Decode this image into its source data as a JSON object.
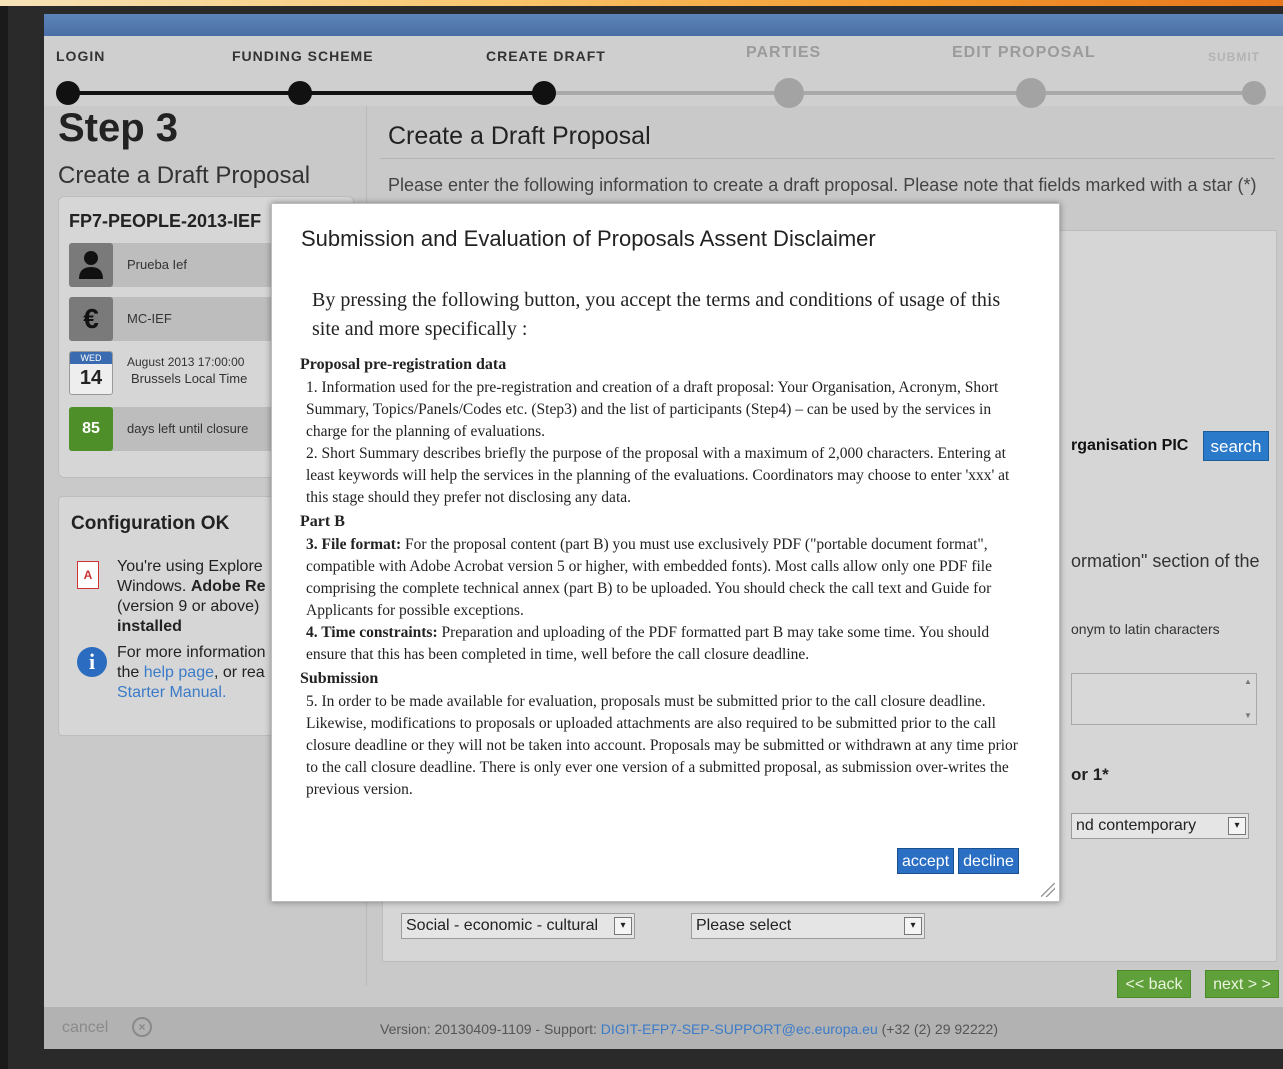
{
  "steps": [
    {
      "label": "LOGIN"
    },
    {
      "label": "FUNDING SCHEME"
    },
    {
      "label": "CREATE DRAFT"
    },
    {
      "label": "PARTIES"
    },
    {
      "label": "EDIT PROPOSAL"
    },
    {
      "label": "SUBMIT"
    }
  ],
  "left": {
    "step_number": "Step 3",
    "step_subtitle": "Create a Draft Proposal",
    "call_id": "FP7-PEOPLE-2013-IEF",
    "acronym": "Prueba Ief",
    "scheme": "MC-IEF",
    "deadline_line1": "August 2013 17:00:00",
    "deadline_line2": "Brussels Local Time",
    "deadline_dow": "WED",
    "deadline_day": "14",
    "days_left": "85",
    "days_left_label": "days left until closure",
    "config_title": "Configuration OK",
    "config_text_1": "You're using Explore",
    "config_text_2": "Windows.",
    "config_text_bold": "Adobe Re",
    "config_text_3": "(version 9 or above)",
    "config_text_4": "installed",
    "more_info_1": "For more information",
    "more_info_2": "the",
    "help_link": "help page",
    "more_info_3": ", or rea",
    "starter_link": "Starter Manual."
  },
  "main": {
    "title": "Create a Draft Proposal",
    "intro": "Please enter the following information to create a draft proposal. Please note that fields marked with a star (*) are mandatory.",
    "pic_label": "rganisation PIC",
    "search_label": "search",
    "info_section": "ormation\" section of the",
    "acronym_hint": "onym to latin characters",
    "descriptor_label": "or 1*",
    "descriptor_select": "nd contemporary",
    "select_social": "Social - economic - cultural",
    "select_please": "Please select"
  },
  "nav": {
    "back_label": "<< back",
    "next_label": "next > >"
  },
  "footer": {
    "cancel_label": "cancel",
    "version_prefix": "Version: 20130409-1109 - Support:",
    "support_email": "DIGIT-EFP7-SEP-SUPPORT@ec.europa.eu",
    "support_phone": "(+32 (2) 29 92222)"
  },
  "modal": {
    "title": "Submission and Evaluation of Proposals Assent Disclaimer",
    "intro": "By pressing the following button, you accept the terms and conditions of usage of this site and more specifically :",
    "sections": [
      {
        "heading": "Proposal pre-registration data",
        "paragraphs": [
          {
            "bold": "",
            "text": "1.   Information used for the pre-registration and creation of a draft proposal: Your Organisation, Acronym, Short Summary, Topics/Panels/Codes etc. (Step3) and the list of participants (Step4) – can be used by the services in charge for the planning of evaluations."
          },
          {
            "bold": "",
            "text": "2.   Short Summary describes briefly the purpose of the proposal with a maximum of 2,000 characters. Entering at least keywords will help the services in the planning of the evaluations. Coordinators may choose to enter 'xxx' at this stage should they prefer not disclosing any data."
          }
        ]
      },
      {
        "heading": "Part B",
        "paragraphs": [
          {
            "bold": "3.   File format:",
            "text": " For the proposal content (part B) you must use exclusively PDF (\"portable document format\", compatible with Adobe Acrobat version 5 or higher, with embedded fonts). Most calls allow only one PDF file comprising the complete technical annex (part B) to be uploaded. You should check the call text and Guide for Applicants for possible exceptions."
          },
          {
            "bold": "4.   Time constraints:",
            "text": " Preparation and uploading of the PDF formatted part B may take some time. You should ensure that this has been completed in time, well before the call closure deadline."
          }
        ]
      },
      {
        "heading": "Submission",
        "paragraphs": [
          {
            "bold": "",
            "text": "5.   In order to be made available for evaluation, proposals must be submitted prior to the call closure deadline. Likewise, modifications to proposals or uploaded attachments are also required to be submitted prior to the call closure deadline or they will not be taken into account. Proposals may be submitted or withdrawn at any time prior to the call closure deadline. There is only ever one version of a submitted proposal, as submission over-writes the previous version."
          }
        ]
      }
    ],
    "accept_label": "accept",
    "decline_label": "decline"
  },
  "colors": {
    "accent_blue": "#2b6fc4",
    "nav_green": "#5fa03a",
    "days_green": "#4f8f2a"
  }
}
